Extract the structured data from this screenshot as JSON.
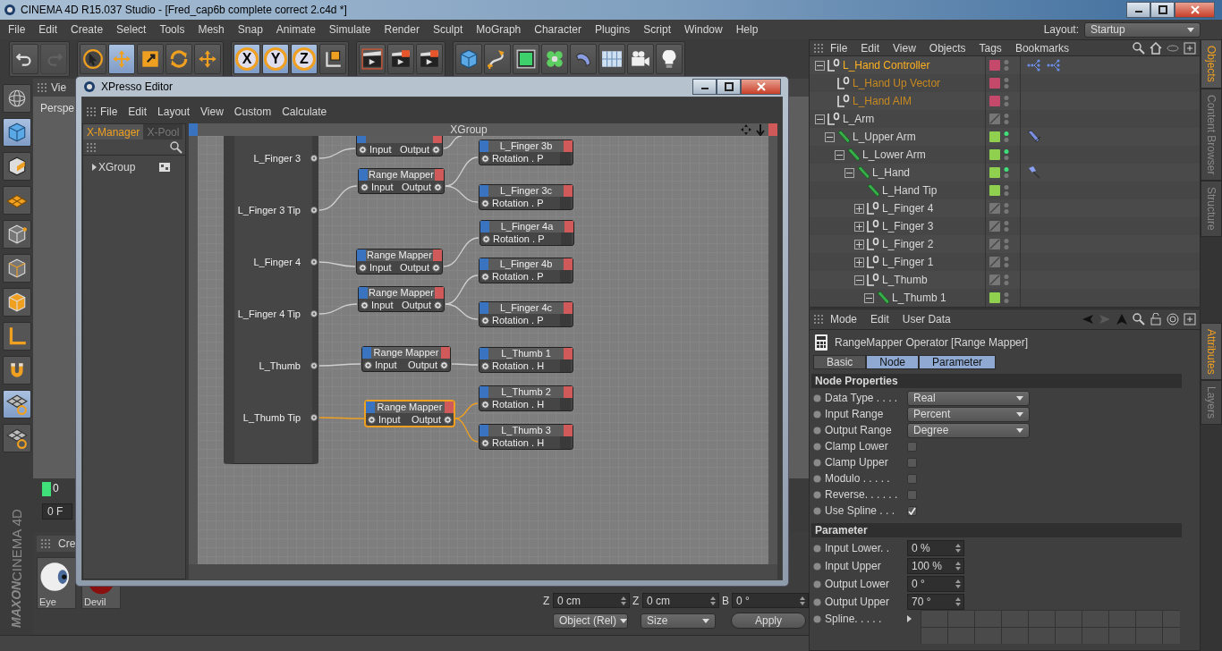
{
  "window": {
    "title": "CINEMA 4D R15.037 Studio - [Fred_cap6b complete correct 2.c4d *]"
  },
  "menu": [
    "File",
    "Edit",
    "Create",
    "Select",
    "Tools",
    "Mesh",
    "Snap",
    "Animate",
    "Simulate",
    "Render",
    "Sculpt",
    "MoGraph",
    "Character",
    "Plugins",
    "Script",
    "Window",
    "Help"
  ],
  "layout": {
    "label": "Layout:",
    "value": "Startup"
  },
  "toolbar": [
    {
      "tools": [
        {
          "kind": "undo",
          "selected": false,
          "disabled": false
        },
        {
          "kind": "redo",
          "selected": false,
          "disabled": true
        }
      ]
    },
    {
      "tools": [
        {
          "kind": "select",
          "selected": false,
          "disabled": false
        },
        {
          "kind": "move",
          "selected": true,
          "disabled": false
        },
        {
          "kind": "scale",
          "selected": false,
          "disabled": false
        },
        {
          "kind": "rotate",
          "selected": false,
          "disabled": false
        },
        {
          "kind": "move",
          "selected": false,
          "disabled": false
        }
      ]
    },
    {
      "tools": [
        {
          "kind": "axis",
          "label": "X",
          "selected": true,
          "disabled": false
        },
        {
          "kind": "axis",
          "label": "Y",
          "selected": true,
          "disabled": false
        },
        {
          "kind": "axis",
          "label": "Z",
          "selected": true,
          "disabled": false
        },
        {
          "kind": "coords",
          "selected": false,
          "disabled": false
        }
      ]
    },
    {
      "tools": [
        {
          "kind": "render-view",
          "selected": false,
          "disabled": false
        },
        {
          "kind": "render",
          "selected": false,
          "disabled": false
        },
        {
          "kind": "render-settings",
          "selected": false,
          "disabled": false
        }
      ]
    },
    {
      "tools": [
        {
          "kind": "cube",
          "selected": false,
          "disabled": false
        },
        {
          "kind": "pen",
          "selected": false,
          "disabled": false
        },
        {
          "kind": "subdivision",
          "selected": false,
          "disabled": false
        },
        {
          "kind": "cloner",
          "selected": false,
          "disabled": false
        },
        {
          "kind": "bend",
          "selected": false,
          "disabled": false
        },
        {
          "kind": "floor",
          "selected": false,
          "disabled": false
        },
        {
          "kind": "camera",
          "selected": false,
          "disabled": false
        },
        {
          "kind": "light",
          "selected": false,
          "disabled": false
        }
      ]
    }
  ],
  "side_tools": [
    {
      "kind": "sphere",
      "selected": false
    },
    {
      "kind": "cube",
      "selected": true
    },
    {
      "kind": "texture",
      "selected": false
    },
    {
      "kind": "plane",
      "selected": false
    },
    {
      "kind": "points",
      "selected": false
    },
    {
      "kind": "edges",
      "selected": false
    },
    {
      "kind": "polygons",
      "selected": false
    },
    {
      "kind": "axis",
      "selected": false
    },
    {
      "kind": "magnet",
      "selected": false
    },
    {
      "kind": "grid-lock",
      "selected": true
    },
    {
      "kind": "grid-snap",
      "selected": false
    }
  ],
  "logo": {
    "brand": "MAXON",
    "product": "CINEMA 4D"
  },
  "viewport": {
    "tab": "Vie",
    "camera": "Perspe"
  },
  "timeline": {
    "frame": "0",
    "field": "0 F"
  },
  "materials": {
    "tab": "Cre",
    "items": [
      {
        "name": "Eye",
        "kind": "eye"
      },
      {
        "name": "Devil",
        "kind": "devil"
      }
    ]
  },
  "coordinates": {
    "fields": [
      {
        "axis": "Z",
        "value": "0 cm"
      },
      {
        "axis": "Z",
        "value": "0 cm"
      },
      {
        "axis": "B",
        "value": "0 °"
      }
    ],
    "mode": "Object (Rel)",
    "size": "Size",
    "apply": "Apply"
  },
  "xpresso": {
    "title": "XPresso Editor",
    "menu": [
      "File",
      "Edit",
      "Layout",
      "View",
      "Custom",
      "Calculate"
    ],
    "tabs": [
      {
        "label": "X-Manager",
        "selected": true
      },
      {
        "label": "X-Pool",
        "selected": false
      }
    ],
    "tree": [
      {
        "label": "XGroup"
      }
    ],
    "group": {
      "title": "XGroup",
      "ports": [
        "L_Finger 3",
        "L_Finger 3 Tip",
        "L_Finger 4",
        "L_Finger 4 Tip",
        "L_Thumb",
        "L_Thumb Tip"
      ]
    },
    "mappers": [
      {
        "input": "Input",
        "output": "Output",
        "selected": false
      },
      {
        "title": "Range Mapper",
        "input": "Input",
        "output": "Output",
        "selected": false
      },
      {
        "title": "Range Mapper",
        "input": "Input",
        "output": "Output",
        "selected": false
      },
      {
        "title": "Range Mapper",
        "input": "Input",
        "output": "Output",
        "selected": false
      },
      {
        "title": "Range Mapper",
        "input": "Input",
        "output": "Output",
        "selected": false
      },
      {
        "title": "Range Mapper",
        "input": "Input",
        "output": "Output",
        "selected": true
      }
    ],
    "targets": [
      {
        "title": "L_Finger 3b",
        "port": "Rotation . P"
      },
      {
        "title": "L_Finger 3c",
        "port": "Rotation . P"
      },
      {
        "title": "L_Finger 4a",
        "port": "Rotation . P"
      },
      {
        "title": "L_Finger 4b",
        "port": "Rotation . P"
      },
      {
        "title": "L_Finger 4c",
        "port": "Rotation . P"
      },
      {
        "title": "L_Thumb 1",
        "port": "Rotation . H"
      },
      {
        "title": "L_Thumb 2",
        "port": "Rotation . H"
      },
      {
        "title": "L_Thumb 3",
        "port": "Rotation . H"
      }
    ]
  },
  "objects": {
    "menu": [
      "File",
      "Edit",
      "View",
      "Objects",
      "Tags",
      "Bookmarks"
    ],
    "tree": [
      {
        "name": "L_Hand Controller",
        "kind": "null",
        "selected": true,
        "expanded": true,
        "color": "#c4496a",
        "active": false,
        "tags": [
          {
            "kind": "constraint"
          },
          {
            "kind": "constraint"
          }
        ],
        "children": [
          {
            "name": "L_Hand Up Vector",
            "kind": "null",
            "selected": false,
            "color": "#c4496a",
            "active": false
          },
          {
            "name": "L_Hand AIM",
            "kind": "null",
            "selected": false,
            "color": "#c4496a",
            "active": false
          }
        ]
      },
      {
        "name": "L_Arm",
        "kind": "null",
        "selected": false,
        "expanded": true,
        "active": false,
        "children": [
          {
            "name": "L_Upper Arm",
            "kind": "joint",
            "selected": false,
            "expanded": true,
            "color": "#8fd14f",
            "active": true,
            "tags": [
              {
                "kind": "ik"
              }
            ],
            "children": [
              {
                "name": "L_Lower Arm",
                "kind": "joint",
                "selected": false,
                "expanded": true,
                "color": "#8fd14f",
                "active": true,
                "children": [
                  {
                    "name": "L_Hand",
                    "kind": "joint",
                    "selected": false,
                    "expanded": true,
                    "color": "#8fd14f",
                    "active": true,
                    "tags": [
                      {
                        "kind": "pin"
                      }
                    ],
                    "children": [
                      {
                        "name": "L_Hand Tip",
                        "kind": "joint",
                        "selected": false,
                        "color": "#8fd14f",
                        "active": false
                      },
                      {
                        "name": "L_Finger 4",
                        "kind": "null",
                        "selected": false,
                        "expanded": false,
                        "active": false
                      },
                      {
                        "name": "L_Finger 3",
                        "kind": "null",
                        "selected": false,
                        "expanded": false,
                        "active": false
                      },
                      {
                        "name": "L_Finger 2",
                        "kind": "null",
                        "selected": false,
                        "expanded": false,
                        "active": false
                      },
                      {
                        "name": "L_Finger 1",
                        "kind": "null",
                        "selected": false,
                        "expanded": false,
                        "active": false
                      },
                      {
                        "name": "L_Thumb",
                        "kind": "null",
                        "selected": false,
                        "expanded": true,
                        "active": false,
                        "children": [
                          {
                            "name": "L_Thumb 1",
                            "kind": "joint",
                            "selected": false,
                            "expanded": true,
                            "color": "#8fd14f",
                            "active": false
                          }
                        ]
                      }
                    ]
                  }
                ]
              }
            ]
          }
        ]
      }
    ]
  },
  "side_tabs_top": [
    {
      "label": "Objects",
      "selected": true
    },
    {
      "label": "Content Browser",
      "selected": false
    },
    {
      "label": "Structure",
      "selected": false
    }
  ],
  "side_tabs_bottom": [
    {
      "label": "Attributes",
      "selected": true
    },
    {
      "label": "Layers",
      "selected": false
    }
  ],
  "attributes": {
    "menu": [
      "Mode",
      "Edit",
      "User Data"
    ],
    "title": "RangeMapper Operator [Range Mapper]",
    "tabs": [
      {
        "label": "Basic",
        "selected": false
      },
      {
        "label": "Node",
        "selected": true
      },
      {
        "label": "Parameter",
        "selected": true
      }
    ],
    "sections": [
      {
        "title": "Node Properties",
        "rows": [
          {
            "kind": "select",
            "label": "Data Type . . . .",
            "value": "Real"
          },
          {
            "kind": "select",
            "label": "Input Range",
            "value": "Percent"
          },
          {
            "kind": "select",
            "label": "Output Range",
            "value": "Degree"
          },
          {
            "kind": "checkbox",
            "label": "Clamp Lower",
            "checked": false
          },
          {
            "kind": "checkbox",
            "label": "Clamp Upper",
            "checked": false
          },
          {
            "kind": "checkbox",
            "label": "Modulo . . . . .",
            "checked": false
          },
          {
            "kind": "checkbox",
            "label": "Reverse. . . . . .",
            "checked": false
          },
          {
            "kind": "checkbox",
            "label": "Use Spline . . .",
            "checked": true
          }
        ]
      },
      {
        "title": "Parameter",
        "rows": [
          {
            "kind": "number",
            "label": "Input Lower. .",
            "value": "0 %"
          },
          {
            "kind": "number",
            "label": "Input Upper",
            "value": "100 %"
          },
          {
            "kind": "number",
            "label": "Output Lower",
            "value": "0 °"
          },
          {
            "kind": "number",
            "label": "Output Upper",
            "value": "70 °"
          },
          {
            "kind": "spline",
            "label": "Spline. . . . ."
          }
        ]
      }
    ]
  }
}
